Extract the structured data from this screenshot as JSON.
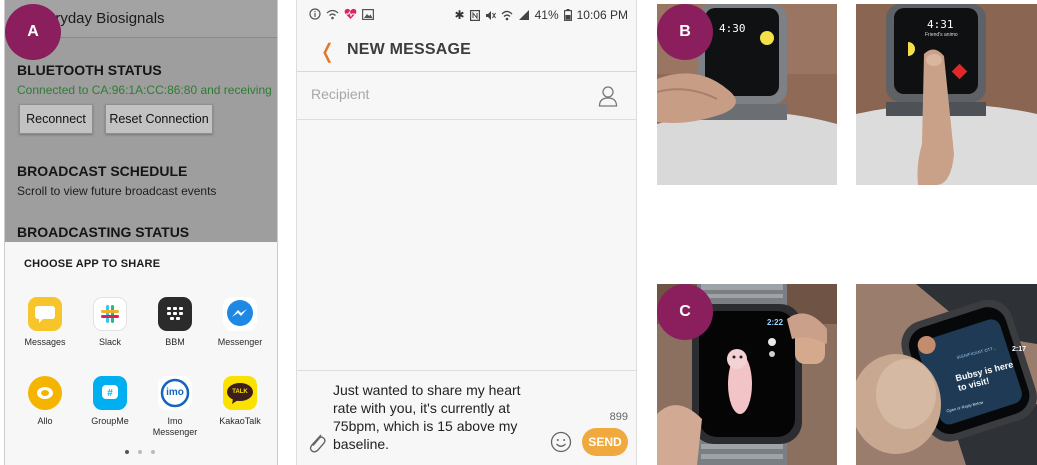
{
  "labels": {
    "a": "A",
    "b": "B",
    "c": "C"
  },
  "panel_a": {
    "app_title": "eryday Biosignals",
    "bluetooth_title": "BLUETOOTH STATUS",
    "bluetooth_status": "Connected to CA:96:1A:CC:86:80 and receiving",
    "reconnect_label": "Reconnect",
    "reset_label": "Reset Connection",
    "schedule_title": "BROADCAST SCHEDULE",
    "schedule_text": "Scroll to view future broadcast events",
    "broadcasting_title": "BROADCASTING STATUS",
    "share_title": "CHOOSE APP TO SHARE",
    "apps": [
      {
        "label": "Messages",
        "icon": "messages-icon",
        "color": "#f7c52a"
      },
      {
        "label": "Slack",
        "icon": "slack-icon",
        "color": "#ffffff"
      },
      {
        "label": "BBM",
        "icon": "bbm-icon",
        "color": "#2b2b2b"
      },
      {
        "label": "Messenger",
        "icon": "messenger-icon",
        "color": "#ffffff"
      },
      {
        "label": "Allo",
        "icon": "allo-icon",
        "color": "#f4b400"
      },
      {
        "label": "GroupMe",
        "icon": "groupme-icon",
        "color": "#00aff0"
      },
      {
        "label": "Imo\nMessenger",
        "icon": "imo-icon",
        "color": "#ffffff"
      },
      {
        "label": "KakaoTalk",
        "icon": "kakaotalk-icon",
        "color": "#fae100"
      }
    ],
    "kakao_icon_text": "TALK",
    "imo_icon_text": "imo"
  },
  "phone": {
    "status_right": "41%",
    "time": "10:06 PM",
    "title": "NEW MESSAGE",
    "recipient_placeholder": "Recipient",
    "message_text": "Just wanted to share my heart rate with you, it's currently at 75bpm, which is 15 above my baseline.",
    "char_count": "899",
    "send_label": "SEND"
  },
  "watch_b": {
    "left_time": "4:30",
    "right_time": "4:31",
    "right_sub": "Friend's animo"
  },
  "watch_c": {
    "left_time": "2:22",
    "right_time": "2:17",
    "card_title": "SIGNIFICANT OTT...",
    "card_text": "Bubsy is here to visit!",
    "card_foot": "Open or Reply Below"
  },
  "colors": {
    "badge": "#8b1f5e",
    "accent_orange": "#e2782d",
    "send": "#f0a93e",
    "green_status": "#2e7d32"
  }
}
